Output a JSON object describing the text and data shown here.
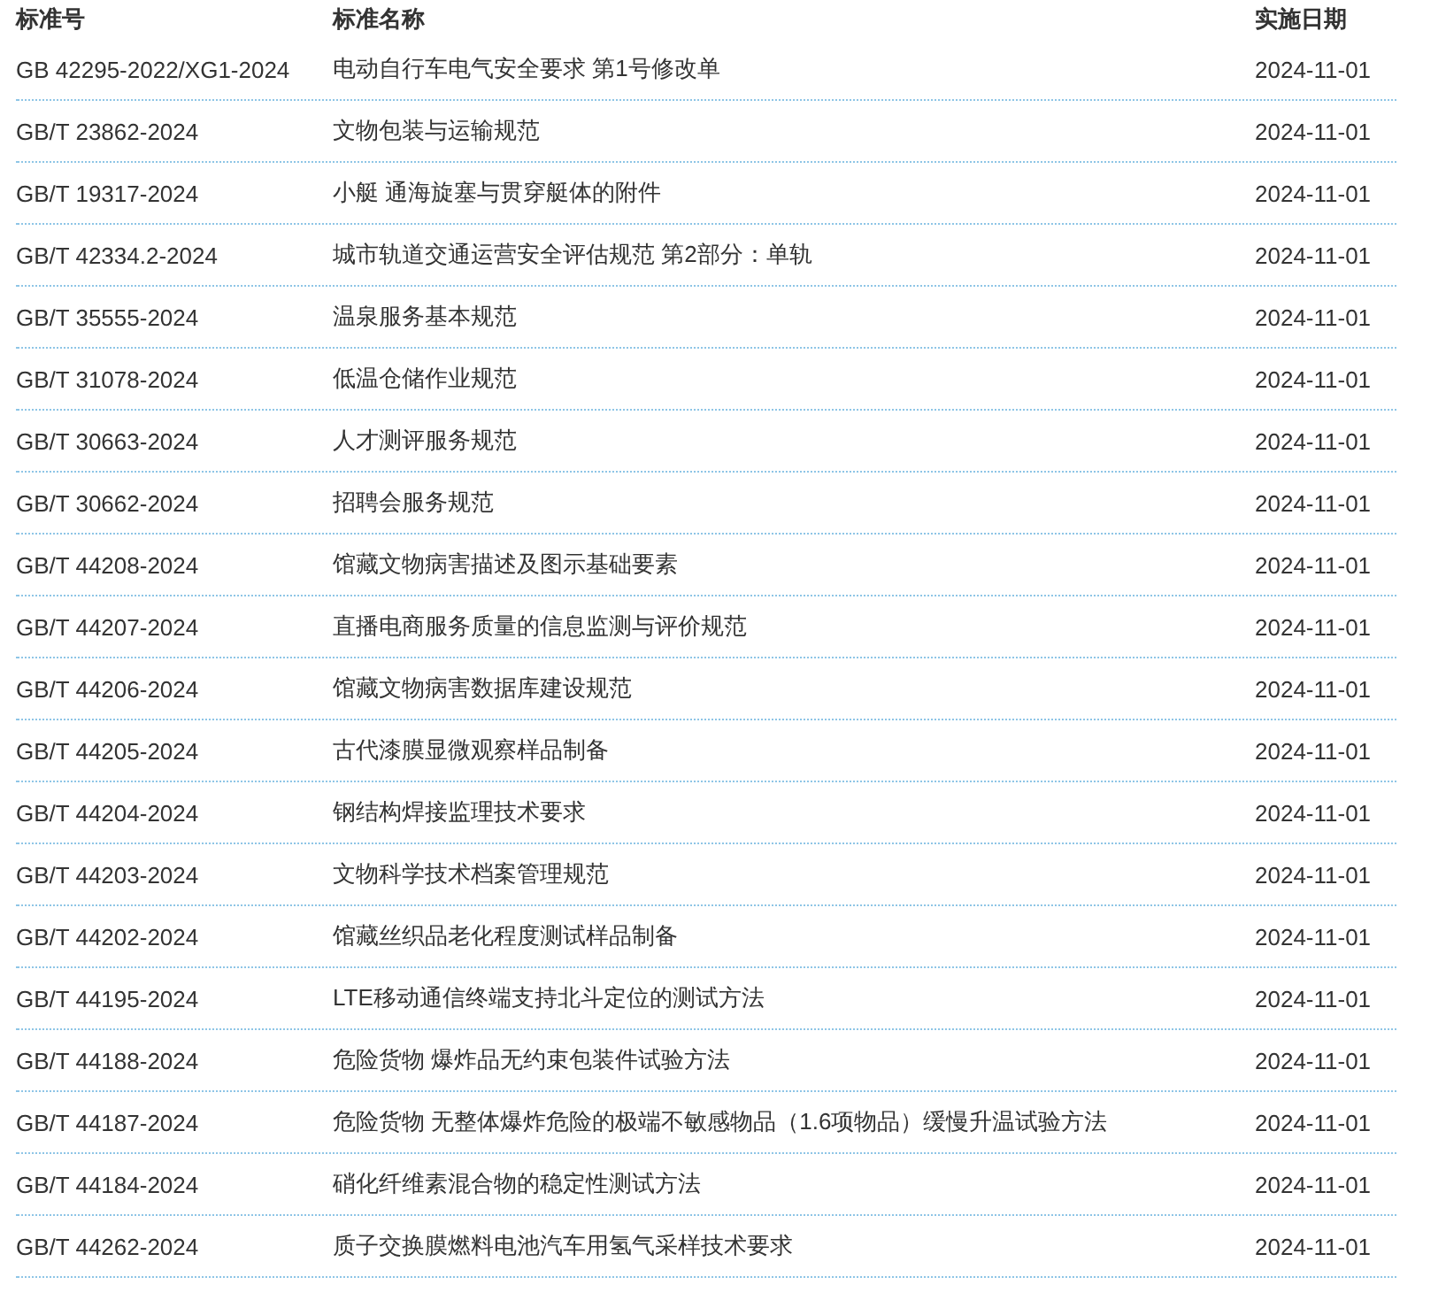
{
  "table": {
    "columns": [
      "标准号",
      "标准名称",
      "实施日期"
    ],
    "rows": [
      {
        "code": "GB 42295-2022/XG1-2024",
        "name": "电动自行车电气安全要求 第1号修改单",
        "date": "2024-11-01"
      },
      {
        "code": "GB/T 23862-2024",
        "name": "文物包装与运输规范",
        "date": "2024-11-01"
      },
      {
        "code": "GB/T 19317-2024",
        "name": "小艇 通海旋塞与贯穿艇体的附件",
        "date": "2024-11-01"
      },
      {
        "code": "GB/T 42334.2-2024",
        "name": "城市轨道交通运营安全评估规范 第2部分：单轨",
        "date": "2024-11-01"
      },
      {
        "code": "GB/T 35555-2024",
        "name": "温泉服务基本规范",
        "date": "2024-11-01"
      },
      {
        "code": "GB/T 31078-2024",
        "name": "低温仓储作业规范",
        "date": "2024-11-01"
      },
      {
        "code": "GB/T 30663-2024",
        "name": "人才测评服务规范",
        "date": "2024-11-01"
      },
      {
        "code": "GB/T 30662-2024",
        "name": "招聘会服务规范",
        "date": "2024-11-01"
      },
      {
        "code": "GB/T 44208-2024",
        "name": "馆藏文物病害描述及图示基础要素",
        "date": "2024-11-01"
      },
      {
        "code": "GB/T 44207-2024",
        "name": "直播电商服务质量的信息监测与评价规范",
        "date": "2024-11-01"
      },
      {
        "code": "GB/T 44206-2024",
        "name": "馆藏文物病害数据库建设规范",
        "date": "2024-11-01"
      },
      {
        "code": "GB/T 44205-2024",
        "name": "古代漆膜显微观察样品制备",
        "date": "2024-11-01"
      },
      {
        "code": "GB/T 44204-2024",
        "name": "钢结构焊接监理技术要求",
        "date": "2024-11-01"
      },
      {
        "code": "GB/T 44203-2024",
        "name": "文物科学技术档案管理规范",
        "date": "2024-11-01"
      },
      {
        "code": "GB/T 44202-2024",
        "name": "馆藏丝织品老化程度测试样品制备",
        "date": "2024-11-01"
      },
      {
        "code": "GB/T 44195-2024",
        "name": "LTE移动通信终端支持北斗定位的测试方法",
        "date": "2024-11-01"
      },
      {
        "code": "GB/T 44188-2024",
        "name": "危险货物 爆炸品无约束包装件试验方法",
        "date": "2024-11-01"
      },
      {
        "code": "GB/T 44187-2024",
        "name": "危险货物 无整体爆炸危险的极端不敏感物品（1.6项物品）缓慢升温试验方法",
        "date": "2024-11-01"
      },
      {
        "code": "GB/T 44184-2024",
        "name": "硝化纤维素混合物的稳定性测试方法",
        "date": "2024-11-01"
      },
      {
        "code": "GB/T 44262-2024",
        "name": "质子交换膜燃料电池汽车用氢气采样技术要求",
        "date": "2024-11-01"
      }
    ]
  }
}
